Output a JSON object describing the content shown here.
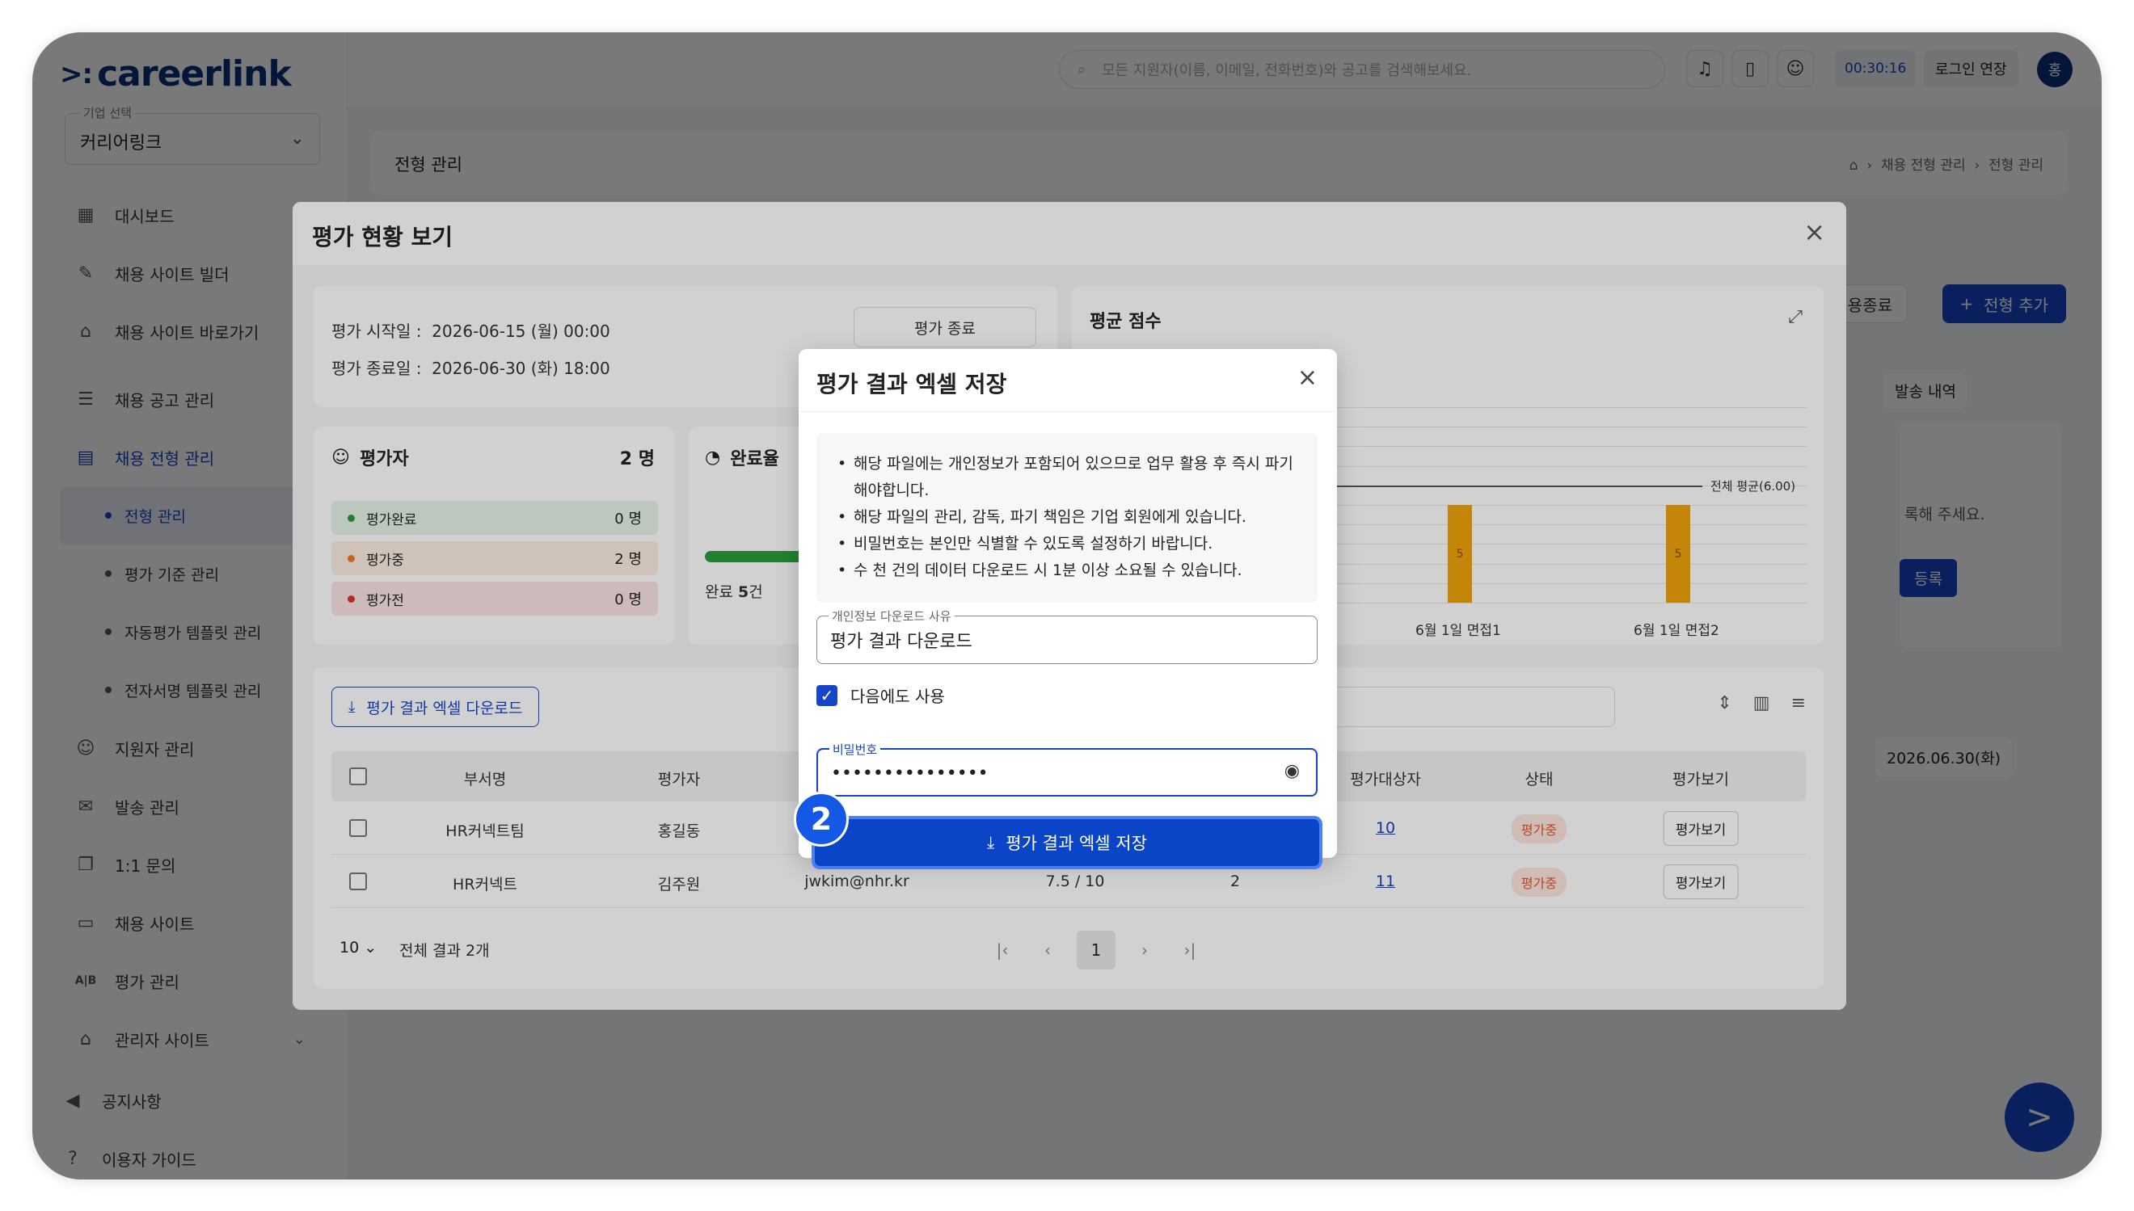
{
  "app": {
    "logo": "careerlink",
    "company_label": "기업 선택",
    "company_value": "커리어링크"
  },
  "sidebar": {
    "items": [
      {
        "label": "대시보드",
        "icon": "chart-icon"
      },
      {
        "label": "채용 사이트 빌더",
        "icon": "tools-icon"
      },
      {
        "label": "채용 사이트 바로가기",
        "icon": "home-icon"
      },
      {
        "label": "채용 공고 관리",
        "icon": "list-icon"
      },
      {
        "label": "채용 전형 관리",
        "icon": "clipboard-icon"
      },
      {
        "label": "전형 관리"
      },
      {
        "label": "평가 기준 관리"
      },
      {
        "label": "자동평가 템플릿 관리"
      },
      {
        "label": "전자서명 템플릿 관리"
      },
      {
        "label": "지원자 관리",
        "icon": "users-icon"
      },
      {
        "label": "발송 관리",
        "icon": "mail-icon"
      },
      {
        "label": "1:1 문의",
        "icon": "chat-icon"
      },
      {
        "label": "채용 사이트",
        "icon": "calendar-icon"
      },
      {
        "label": "평가 관리",
        "icon": "ab-icon"
      },
      {
        "label": "관리자 사이트",
        "icon": "admin-home-icon"
      },
      {
        "label": "공지사항",
        "icon": "megaphone-icon"
      },
      {
        "label": "이용자 가이드",
        "icon": "help-icon"
      }
    ]
  },
  "topbar": {
    "search_placeholder": "모든 지원자(이름, 이메일, 전화번호)와 공고를 검색해보세요.",
    "timer": "00:30:16",
    "login_extend": "로그인 연장",
    "avatar": "홍"
  },
  "page": {
    "title": "전형 관리",
    "breadcrumb_1": "채용 전형 관리",
    "breadcrumb_2": "전형 관리",
    "btn_close_hiring": "채용종료",
    "btn_add_stage": "전형 추가",
    "bg_send_history": "발송 내역",
    "bg_register_hint": "록해 주세요.",
    "bg_register_btn": "등록",
    "bg_date": "2026.06.30(화)"
  },
  "modal1": {
    "title": "평가 현황 보기",
    "start_label": "평가 시작일 :",
    "start_value": "2026-06-15 (월) 00:00",
    "end_label": "평가 종료일 :",
    "end_value": "2026-06-30 (화) 18:00",
    "end_button": "평가 종료",
    "evaluator_title": "평가자",
    "evaluator_count": "2 명",
    "status_rows": [
      {
        "label": "평가완료",
        "count": "0 명",
        "color": "#2a9d3a",
        "bg": "#e6f4e8"
      },
      {
        "label": "평가중",
        "count": "2 명",
        "color": "#f07a2a",
        "bg": "#fdeee2"
      },
      {
        "label": "평가전",
        "count": "0 명",
        "color": "#d9342b",
        "bg": "#fbe4e4"
      }
    ],
    "completion_title": "완료율",
    "completion_fraction": 0.31,
    "completion_label_prefix": "완료",
    "completion_label_value": "5",
    "completion_label_suffix": "건",
    "avg_title": "평균 점수",
    "download_button": "평가 결과 엑셀 다운로드",
    "table": {
      "headers": [
        "부서명",
        "평가자",
        "평가대상자",
        "상태",
        "평가보기"
      ],
      "rows": [
        {
          "dept": "HR커넥트팀",
          "evaluator": "홍길동",
          "email": "",
          "score": "",
          "count": "",
          "targets": "10",
          "status": "평가중",
          "view": "평가보기"
        },
        {
          "dept": "HR커넥트",
          "evaluator": "김주원",
          "email": "jwkim@nhr.kr",
          "score": "7.5 / 10",
          "count": "2",
          "targets": "11",
          "status": "평가중",
          "view": "평가보기"
        }
      ]
    },
    "pager": {
      "page_size": "10",
      "total": "전체 결과 2개",
      "current_page": "1"
    }
  },
  "chart_data": {
    "type": "bar",
    "title": "평균 점수",
    "categories": [
      "6월 1일 면접1",
      "6월 1일 면접2"
    ],
    "values": [
      5,
      5
    ],
    "value_labels": [
      "5",
      "5"
    ],
    "reference_line": {
      "label": "전체 평균(6.00)",
      "value": 6.0
    },
    "ylim": [
      0,
      10
    ],
    "grid": true,
    "colors": {
      "bar": "#f0a30a"
    }
  },
  "modal2": {
    "title": "평가 결과 엑셀 저장",
    "notices": [
      "해당 파일에는 개인정보가 포함되어 있으므로 업무 활용 후 즉시 파기해야합니다.",
      "해당 파일의 관리, 감독, 파기 책임은 기업 회원에게 있습니다.",
      "비밀번호는 본인만 식별할 수 있도록 설정하기 바랍니다.",
      "수 천 건의 데이터 다운로드 시 1분 이상 소요될 수 있습니다."
    ],
    "reason_label": "개인정보 다운로드 사유",
    "reason_value": "평가 결과 다운로드",
    "reuse_label": "다음에도 사용",
    "password_label": "비밀번호",
    "password_value": "•••••••••••••••",
    "save_button": "평가 결과 엑셀 저장",
    "step_number": "2"
  }
}
